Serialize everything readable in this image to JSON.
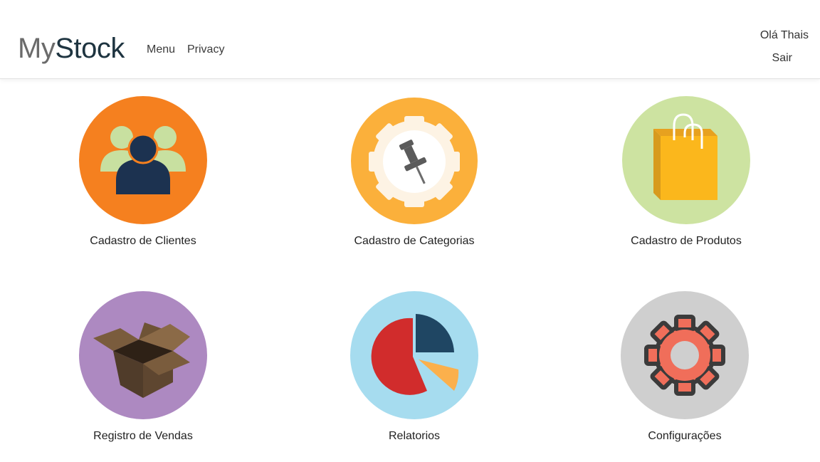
{
  "brand": {
    "part1": "My",
    "part2": "Stock"
  },
  "nav": {
    "menu": "Menu",
    "privacy": "Privacy"
  },
  "user": {
    "greeting": "Olá Thais",
    "logout": "Sair"
  },
  "tiles": [
    {
      "label": "Cadastro de Clientes",
      "icon": "users-icon",
      "bg": "#f5801f"
    },
    {
      "label": "Cadastro de Categorias",
      "icon": "pushpin-gear-icon",
      "bg": "#fbb03b"
    },
    {
      "label": "Cadastro de Produtos",
      "icon": "shopping-bag-icon",
      "bg": "#cde3a1"
    },
    {
      "label": "Registro de Vendas",
      "icon": "box-icon",
      "bg": "#ad89c1"
    },
    {
      "label": "Relatorios",
      "icon": "pie-chart-icon",
      "bg": "#a6dcef"
    },
    {
      "label": "Configurações",
      "icon": "gear-icon",
      "bg": "#cfcfcf"
    }
  ]
}
